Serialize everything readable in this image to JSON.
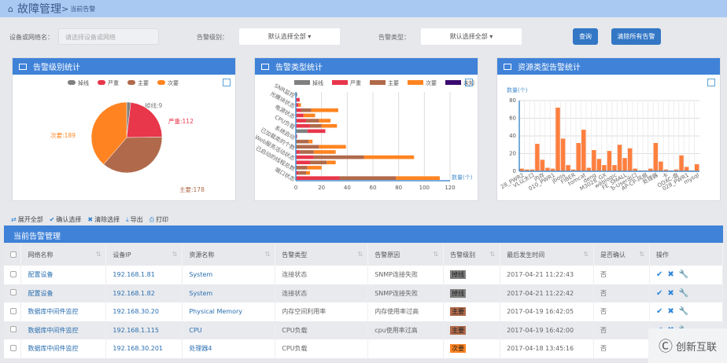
{
  "header": {
    "title": "故障管理",
    "breadcrumb": "当前告警",
    "home_icon": "home-icon"
  },
  "filters": {
    "device_label": "设备或网络名：",
    "device_placeholder": "请选择设备或网络",
    "level_label": "告警级别：",
    "level_value": "默认选择全部",
    "type_label": "告警类型：",
    "type_value": "默认选择全部",
    "query": "查询",
    "clear_all": "清除所有告警"
  },
  "colors": {
    "drop": "#7f7f7f",
    "severe": "#e8364a",
    "major": "#b06a4b",
    "minor": "#ff8421",
    "unknown": "#3a0a6e",
    "accent": "#3f82d8"
  },
  "panels": {
    "level": "告警级别统计",
    "type": "告警类型统计",
    "resource": "资源类型告警统计"
  },
  "chart_data": [
    {
      "type": "pie",
      "legend": [
        "掉线",
        "严重",
        "主要",
        "次要"
      ],
      "legend_position": "top",
      "slices": [
        {
          "name": "掉线",
          "value": 9,
          "label": "掉线:9"
        },
        {
          "name": "严重",
          "value": 112,
          "label": "严重:112"
        },
        {
          "name": "主要",
          "value": 178,
          "label": "主要:178"
        },
        {
          "name": "次要",
          "value": 189,
          "label": "次要:189"
        }
      ]
    },
    {
      "type": "bar",
      "orientation": "horizontal",
      "stacked": true,
      "legend": [
        "掉线",
        "严重",
        "主要",
        "次要",
        "未知"
      ],
      "legend_position": "top",
      "xlabel": "数量(个)",
      "xlim": [
        0,
        120
      ],
      "xticks": [
        "0",
        "20",
        "40",
        "60",
        "80",
        "100",
        "120"
      ],
      "grid": true,
      "categories": [
        "SNR监控",
        "",
        "光模块状态",
        "",
        "电源状态",
        "",
        "CPU负载",
        "",
        "系统启动",
        "",
        "已加载类的个数",
        "",
        "Web服务活动状态",
        "",
        "已启动的线程总数",
        "",
        "端口状态"
      ],
      "series": [
        {
          "name": "掉线",
          "values": [
            1,
            0,
            0,
            0,
            0,
            0,
            0,
            9,
            0,
            0,
            0,
            0,
            0,
            0,
            0,
            0,
            0
          ]
        },
        {
          "name": "严重",
          "values": [
            0,
            3,
            2,
            4,
            6,
            8,
            11,
            14,
            1,
            0,
            0,
            3,
            14,
            11,
            0,
            2,
            34
          ]
        },
        {
          "name": "主要",
          "values": [
            0,
            0,
            0,
            8,
            0,
            10,
            9,
            0,
            0,
            10,
            18,
            11,
            39,
            13,
            9,
            6,
            44
          ]
        },
        {
          "name": "次要",
          "values": [
            0,
            0,
            2,
            21,
            9,
            9,
            12,
            0,
            0,
            3,
            21,
            17,
            39,
            7,
            11,
            3,
            34
          ]
        },
        {
          "name": "未知",
          "values": [
            0,
            0,
            0,
            0,
            0,
            0,
            0,
            0,
            0,
            0,
            0,
            0,
            0,
            0,
            0,
            0,
            0
          ]
        }
      ]
    },
    {
      "type": "bar",
      "ylabel": "数量(个)",
      "ylim": [
        0,
        80
      ],
      "yticks": [
        "0",
        "20",
        "40",
        "60",
        "80"
      ],
      "grid": true,
      "categories": [
        "28_PWR2",
        "",
        "VL以太口",
        "",
        "内存",
        "",
        "010_PWR1",
        "",
        "jboss",
        "",
        "FIBER",
        "",
        "tomcat",
        "",
        "deng",
        "",
        "M3028_GX",
        "",
        "weblogic",
        "",
        "FE_SMALL",
        "",
        "b-User出口",
        "",
        "AP-CP-风扇",
        "",
        "处理器",
        "",
        "卡",
        "",
        "ODXC-盘",
        "",
        "028_PWR1",
        "",
        "mysql"
      ],
      "values": [
        3,
        2,
        2,
        31,
        13,
        4,
        3,
        72,
        37,
        7,
        2,
        32,
        47,
        4,
        24,
        14,
        7,
        23,
        7,
        30,
        15,
        26,
        3,
        1,
        1,
        3,
        32,
        11,
        2,
        1,
        2,
        18,
        5,
        1,
        8
      ]
    }
  ],
  "toolbar": [
    "展开全部",
    "确认选择",
    "清除选择",
    "导出",
    "打印"
  ],
  "table": {
    "title": "当前告警管理",
    "columns": [
      "网络名称",
      "设备IP",
      "资源名称",
      "告警类型",
      "告警原因",
      "告警级别",
      "最后发生时间",
      "是否确认",
      "操作"
    ],
    "rows": [
      {
        "network": "配置设备",
        "ip": "192.168.1.81",
        "resource": "System",
        "type": "连接状态",
        "reason": "SNMP连接失败",
        "level": "掉线",
        "level_color": "#7f7f7f",
        "time": "2017-04-21 11:22:43",
        "confirmed": "否"
      },
      {
        "network": "配置设备",
        "ip": "192.168.1.82",
        "resource": "System",
        "type": "连接状态",
        "reason": "SNMP连接失败",
        "level": "掉线",
        "level_color": "#7f7f7f",
        "time": "2017-04-21 11:22:42",
        "confirmed": "否"
      },
      {
        "network": "数据库中间件监控",
        "ip": "192.168.30.20",
        "resource": "Physical Memory",
        "type": "内存空间利用率",
        "reason": "内存使用率过高",
        "level": "主要",
        "level_color": "#b06a4b",
        "time": "2017-04-19 16:42:05",
        "confirmed": "否"
      },
      {
        "network": "数据库中间件监控",
        "ip": "192.168.1.115",
        "resource": "CPU",
        "type": "CPU负载",
        "reason": "cpu使用率过高",
        "level": "主要",
        "level_color": "#b06a4b",
        "time": "2017-04-19 16:42:00",
        "confirmed": "否"
      },
      {
        "network": "数据库中间件监控",
        "ip": "192.168.30.201",
        "resource": "处理器4",
        "type": "CPU负载",
        "reason": "",
        "level": "次要",
        "level_color": "#ff8421",
        "time": "2017-04-18 13:45:16",
        "confirmed": "否"
      }
    ]
  },
  "watermark": "创新互联"
}
